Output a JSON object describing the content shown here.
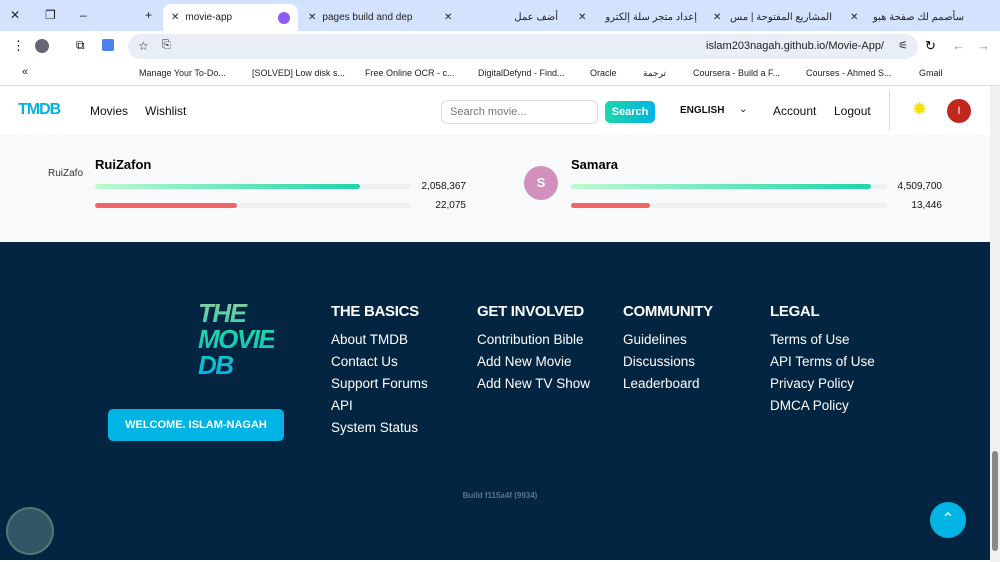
{
  "browser": {
    "tabs": [
      {
        "label": "movie-app",
        "active": true
      },
      {
        "label": "pages build and dep"
      },
      {
        "label": "أضف عمل"
      },
      {
        "label": "إعداد متجر سلة إلكترو"
      },
      {
        "label": "المشاريع المفتوحة | مس"
      },
      {
        "label": "سأصمم لك صفحة هبو"
      }
    ],
    "url": "islam203nagah.github.io/Movie-App/",
    "bookmarks": [
      "Manage Your To-Do...",
      "[SOLVED] Low disk s...",
      "Free Online OCR - c...",
      "DigitalDefynd - Find...",
      "Oracle",
      "ترجمة",
      "Coursera - Build a F...",
      "Courses - Ahmed S...",
      "Gmail"
    ]
  },
  "header": {
    "logo": "TMDB",
    "nav": [
      "Movies",
      "Wishlist"
    ],
    "search_placeholder": "Search movie...",
    "search_button": "Search",
    "language": "ENGLISH",
    "account": "Account",
    "logout": "Logout",
    "avatar_initial": "I"
  },
  "leaders": [
    {
      "name": "RuiZafon",
      "img_alt": "RuiZafon",
      "all_time": "2,058,367",
      "this_week": "22,075",
      "all_time_pct": 84,
      "week_pct": 45
    },
    {
      "name": "Samara",
      "initial": "S",
      "all_time": "4,509,700",
      "this_week": "13,446",
      "all_time_pct": 95,
      "week_pct": 25
    }
  ],
  "colors": {
    "footer_bg": "#032541",
    "accent": "#01b4e4",
    "green": "#1ed5a9"
  },
  "footer": {
    "logo": [
      "THE",
      "MOVIE",
      "DB"
    ],
    "welcome": "WELCOME. ISLAM-NAGAH",
    "columns": [
      {
        "title": "THE BASICS",
        "links": [
          "About TMDB",
          "Contact Us",
          "Support Forums",
          "API",
          "System Status"
        ]
      },
      {
        "title": "GET INVOLVED",
        "links": [
          "Contribution Bible",
          "Add New Movie",
          "Add New TV Show"
        ]
      },
      {
        "title": "COMMUNITY",
        "links": [
          "Guidelines",
          "Discussions",
          "Leaderboard"
        ]
      },
      {
        "title": "LEGAL",
        "links": [
          "Terms of Use",
          "API Terms of Use",
          "Privacy Policy",
          "DMCA Policy"
        ]
      }
    ],
    "build": "Build f115a4f (9934)"
  }
}
